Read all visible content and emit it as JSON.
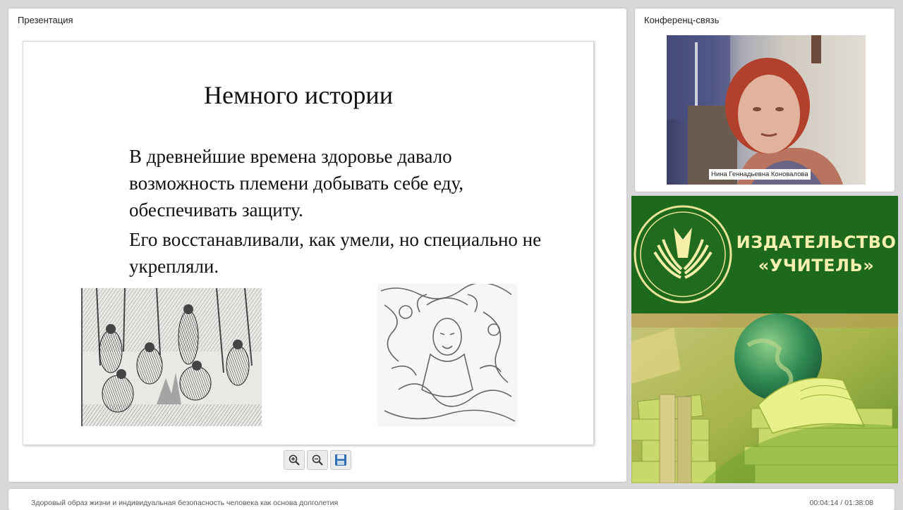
{
  "presentation": {
    "panel_title": "Презентация",
    "slide": {
      "title": "Немного истории",
      "paragraphs": [
        "В древнейшие времена здоровье давало возможность племени добывать себе еду, обеспечивать защиту.",
        "Его восстанавливали, как умели, но специально не укрепляли."
      ]
    },
    "toolbar": {
      "zoom_in_icon": "zoom-in-icon",
      "zoom_out_icon": "zoom-out-icon",
      "save_icon": "save-icon"
    }
  },
  "conference": {
    "panel_title": "Конференц-связь",
    "participant_name": "Нина Геннадьевна Коновалова"
  },
  "banner": {
    "publisher_line1": "ИЗДАТЕЛЬСТВО",
    "publisher_line2": "«УЧИТЕЛЬ»",
    "colors": {
      "green": "#1e6a1c",
      "text": "#f5efb0"
    }
  },
  "footer": {
    "title": "Здоровый образ жизни и индивидуальная безопасность человека как основа долголетия",
    "time": "00:04:14 / 01:38:08"
  }
}
